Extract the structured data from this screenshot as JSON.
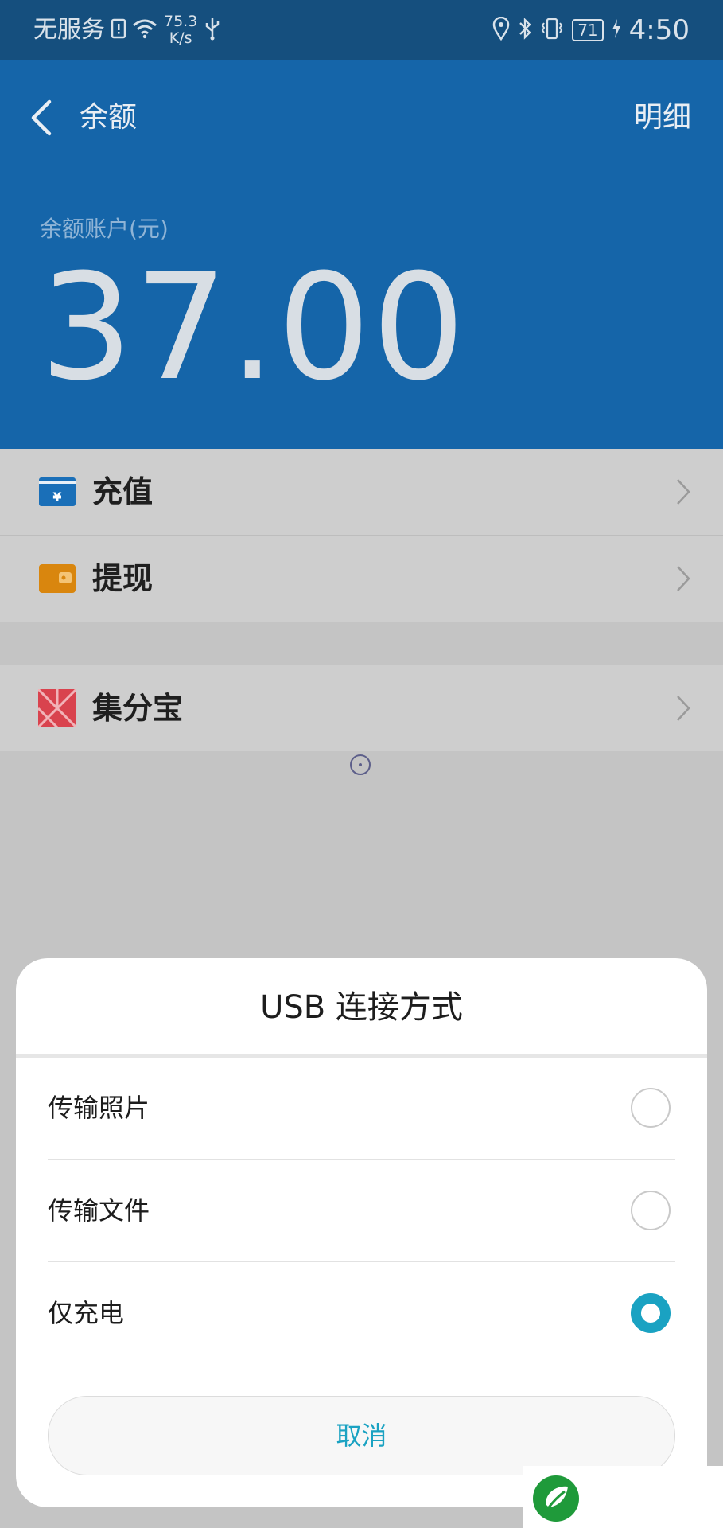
{
  "status_bar": {
    "carrier": "无服务",
    "net_speed_value": "75.3",
    "net_speed_unit": "K/s",
    "battery": "71",
    "time": "4:50",
    "icons": [
      "sim-alert-icon",
      "wifi-icon",
      "usb-icon",
      "location-icon",
      "bluetooth-icon",
      "vibrate-icon",
      "charging-icon"
    ]
  },
  "header": {
    "back_icon": "chevron-left-icon",
    "title": "余额",
    "detail_link": "明细",
    "balance_label": "余额账户(元)",
    "balance_amount": "37.00",
    "background_color": "#1565a9"
  },
  "menu": {
    "group1": [
      {
        "label": "充值",
        "icon": "recharge-yuan-card-icon",
        "icon_color": "#1a6fb8"
      },
      {
        "label": "提现",
        "icon": "wallet-withdraw-icon",
        "icon_color": "#d9860e"
      }
    ],
    "group2": [
      {
        "label": "集分宝",
        "icon": "jifenbao-icon",
        "icon_color": "#d9434e"
      }
    ],
    "chevron_icon": "chevron-right-icon"
  },
  "dialog": {
    "title": "USB 连接方式",
    "options": [
      {
        "label": "传输照片",
        "selected": false
      },
      {
        "label": "传输文件",
        "selected": false
      },
      {
        "label": "仅充电",
        "selected": true
      }
    ],
    "cancel_label": "取消",
    "accent_color": "#1aa2c2"
  }
}
